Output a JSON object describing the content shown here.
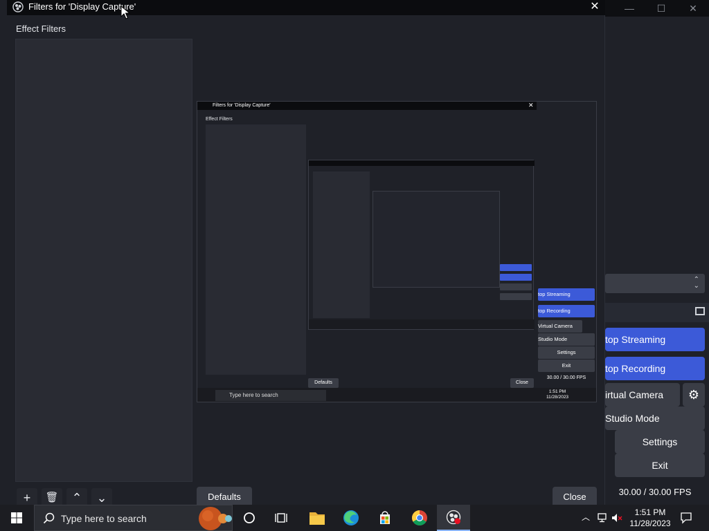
{
  "dialog": {
    "title": "Filters for 'Display Capture'",
    "close_glyph": "✕",
    "effect_filters_label": "Effect Filters",
    "toolbar": {
      "add": "+",
      "remove": "🗑",
      "up": "⌃",
      "down": "⌄"
    },
    "defaults_label": "Defaults",
    "close_label": "Close"
  },
  "obs_controls": {
    "stop_streaming": "top Streaming",
    "stop_recording": "top Recording",
    "virtual_camera": "irtual Camera",
    "studio_mode": "Studio Mode",
    "settings": "Settings",
    "exit": "Exit",
    "fps": "30.00 / 30.00 FPS"
  },
  "preview": {
    "title": "Filters for 'Display Capture'",
    "effect_filters_label": "Effect Filters",
    "stop_streaming": "top Streaming",
    "stop_recording": "top Recording",
    "virtual_camera": "Virtual Camera",
    "studio_mode": "Studio Mode",
    "settings": "Settings",
    "exit": "Exit",
    "fps": "30.00 / 30.00 FPS",
    "defaults_label": "Defaults",
    "close_label": "Close",
    "search_placeholder": "Type here to search",
    "clock_time": "1:51 PM",
    "clock_date": "11/28/2023"
  },
  "taskbar": {
    "search_placeholder": "Type here to search",
    "clock_time": "1:51 PM",
    "clock_date": "11/28/2023",
    "apps": [
      "task-view",
      "cortana",
      "file-explorer",
      "edge",
      "store",
      "chrome",
      "obs"
    ]
  },
  "colors": {
    "accent_blue": "#3c5ad8",
    "button_gray": "#3a3d46",
    "panel_bg": "#1f2128",
    "list_bg": "#292b33",
    "taskbar_bg": "#1c1d22"
  }
}
